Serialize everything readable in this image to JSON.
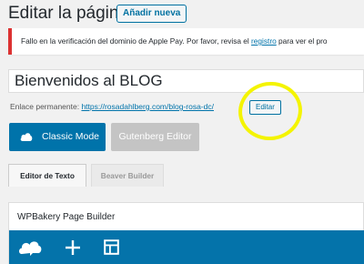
{
  "header": {
    "title": "Editar la página",
    "add_new_label": "Añadir nueva"
  },
  "notice": {
    "text_before": "Fallo en la verificación del dominio de Apple Pay. Por favor, revisa el ",
    "link_text": "registro",
    "text_after": " para ver el pro"
  },
  "post": {
    "title_value": "Bienvenidos al BLOG"
  },
  "permalink": {
    "label": "Enlace permanente:",
    "url": "https://rosadahlberg.com/blog-rosa-dc/",
    "edit_label": "Editar"
  },
  "editor_switch": {
    "classic_label": "Classic Mode",
    "gutenberg_label": "Gutenberg Editor"
  },
  "tabs": [
    {
      "label": "Editor de Texto",
      "active": true
    },
    {
      "label": "Beaver Builder",
      "active": false
    }
  ],
  "wpbakery": {
    "panel_title": "WPBakery Page Builder",
    "toolbar_icons": [
      "wpbakery-logo-icon",
      "plus-icon",
      "layout-template-icon"
    ]
  },
  "colors": {
    "accent": "#0073aa",
    "error": "#dc3232",
    "highlight": "#f4f400"
  }
}
